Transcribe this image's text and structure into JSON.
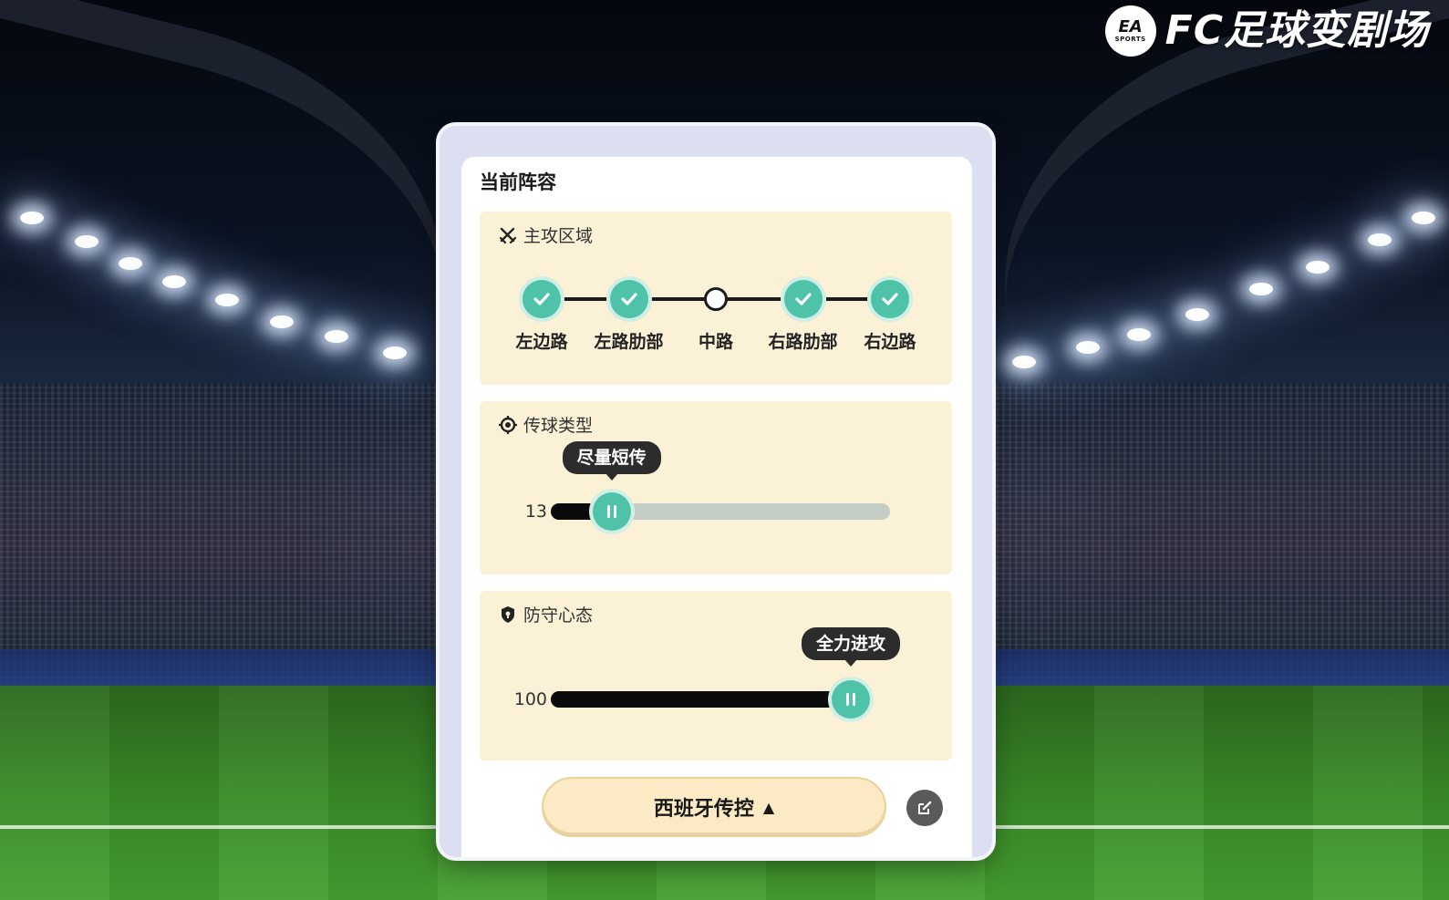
{
  "brand": {
    "ea_mark": "EA",
    "ea_sub": "SPORTS",
    "title": "FC足球变剧场"
  },
  "panel": {
    "title": "当前阵容",
    "attack_zone": {
      "label": "主攻区域",
      "icon": "crossed-swords-icon",
      "options": [
        {
          "label": "左边路",
          "selected": true
        },
        {
          "label": "左路肋部",
          "selected": true
        },
        {
          "label": "中路",
          "selected": false
        },
        {
          "label": "右路肋部",
          "selected": true
        },
        {
          "label": "右边路",
          "selected": true
        }
      ]
    },
    "pass_type": {
      "label": "传球类型",
      "icon": "target-icon",
      "value": "13",
      "value_num": 13,
      "max": 100,
      "tooltip": "尽量短传"
    },
    "defense": {
      "label": "防守心态",
      "icon": "shield-icon",
      "value": "100",
      "value_num": 100,
      "max": 100,
      "tooltip": "全力进攻"
    },
    "formation_button": {
      "label": "西班牙传控",
      "caret": "▲"
    },
    "edit_icon": "edit-icon"
  },
  "colors": {
    "accent": "#4ec3a9",
    "section_bg": "#faf1d6",
    "button_bg": "#fbeac4",
    "frame": "#dcdff2"
  }
}
